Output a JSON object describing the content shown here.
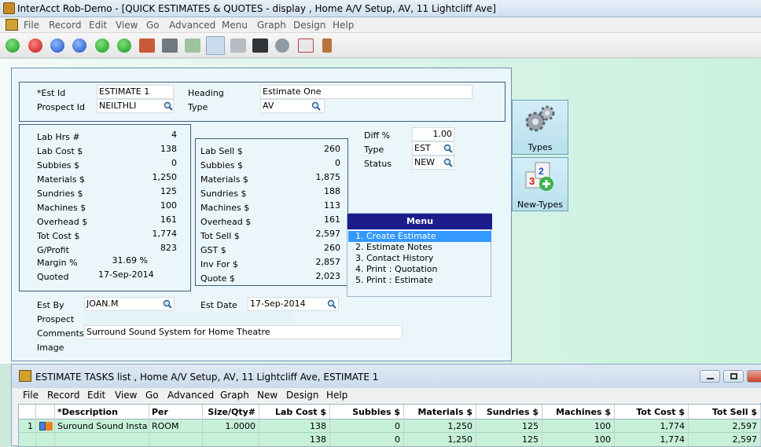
{
  "window": {
    "title": "InterAcct Rob-Demo - [QUICK ESTIMATES & QUOTES - display , Home A/V Setup, AV, 11 Lightcliff Ave]"
  },
  "menubar": [
    "File",
    "Record",
    "Edit",
    "View",
    "Go",
    "Advanced",
    "Menu",
    "Graph",
    "Design",
    "Help"
  ],
  "header": {
    "est_id_label": "*Est Id",
    "est_id": "ESTIMATE 1",
    "prospect_id_label": "Prospect Id",
    "prospect_id": "NEILTHLI",
    "heading_label": "Heading",
    "heading": "Estimate One",
    "type_label": "Type",
    "type": "AV"
  },
  "costs": {
    "rows": [
      {
        "label": "Lab Hrs #",
        "value": "4"
      },
      {
        "label": "Lab Cost $",
        "value": "138"
      },
      {
        "label": "Subbies  $",
        "value": "0"
      },
      {
        "label": "Materials $",
        "value": "1,250"
      },
      {
        "label": "Sundries  $",
        "value": "125"
      },
      {
        "label": "Machines $",
        "value": "100"
      },
      {
        "label": "Overhead $",
        "value": "161"
      },
      {
        "label": "Tot Cost $",
        "value": "1,774"
      },
      {
        "label": "G/Profit",
        "value": "823"
      }
    ],
    "margin_label": "Margin %",
    "margin": "31.69 %",
    "quoted_label": "Quoted",
    "quoted": "17-Sep-2014"
  },
  "sells": {
    "rows": [
      {
        "label": "Lab Sell $",
        "value": "260"
      },
      {
        "label": "Subbies  $",
        "value": "0"
      },
      {
        "label": "Materials $",
        "value": "1,875"
      },
      {
        "label": "Sundries  $",
        "value": "188"
      },
      {
        "label": "Machines $",
        "value": "113"
      },
      {
        "label": "Overhead $",
        "value": "161"
      },
      {
        "label": "Tot Sell $",
        "value": "2,597"
      },
      {
        "label": "GST  $",
        "value": "260"
      },
      {
        "label": "Inv For $",
        "value": "2,857"
      },
      {
        "label": "Quote $",
        "value": "2,023"
      }
    ]
  },
  "diff": {
    "diff_label": "Diff %",
    "diff": "1.00",
    "type_label": "Type",
    "type": "EST",
    "status_label": "Status",
    "status": "NEW"
  },
  "footer": {
    "est_by_label": "Est By",
    "est_by": "JOAN.M",
    "est_date_label": "Est Date",
    "est_date": "17-Sep-2014",
    "prospect_label": "Prospect",
    "comments_label": "Comments",
    "comments": "Surround Sound System for Home Theatre",
    "image_label": "Image"
  },
  "side_buttons": {
    "types": "Types",
    "new_types": "New-Types"
  },
  "menu_panel": {
    "title": "Menu",
    "items": [
      "1. Create Estimate",
      "2. Estimate Notes",
      "3. Contact History",
      "4. Print : Quotation",
      "5. Print : Estimate"
    ]
  },
  "subwindow": {
    "title": "ESTIMATE TASKS list , Home A/V Setup, AV, 11 Lightcliff Ave, ESTIMATE 1",
    "menubar": [
      "File",
      "Record",
      "Edit",
      "View",
      "Go",
      "Advanced",
      "Graph",
      "New",
      "Design",
      "Help"
    ],
    "columns": [
      "*Description",
      "Per",
      "Size/Qty#",
      "Lab Cost $",
      "Subbies  $",
      "Materials $",
      "Sundries  $",
      "Machines $",
      "Tot Cost $",
      "Tot Sell $"
    ],
    "rows": [
      {
        "num": "1",
        "cells": [
          "Suround Sound Insta",
          "ROOM",
          "1.0000",
          "138",
          "0",
          "1,250",
          "125",
          "100",
          "1,774",
          "2,597"
        ]
      },
      {
        "num": "",
        "cells": [
          "",
          "",
          "",
          "138",
          "0",
          "1,250",
          "125",
          "100",
          "1,774",
          "2,597"
        ]
      }
    ]
  },
  "colors": {
    "menu_header": "#1c1c8c",
    "menu_selected": "#3399ff",
    "grid_row": "#c6f0d8"
  }
}
